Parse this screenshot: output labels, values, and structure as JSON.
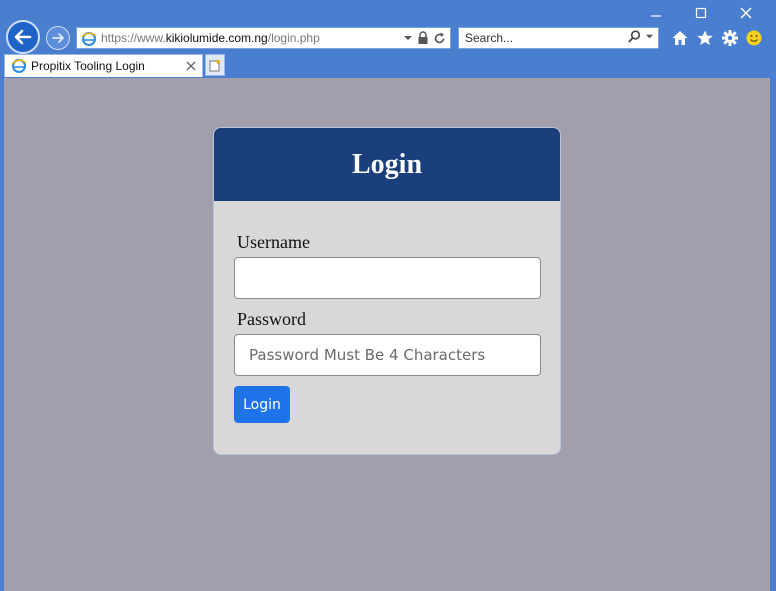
{
  "browser": {
    "address_scheme": "https://www.",
    "address_host": "kikiolumide.com.ng",
    "address_path": "/login.php",
    "search_placeholder": "Search...",
    "tab_title": "Propitix Tooling Login"
  },
  "login": {
    "title": "Login",
    "username_label": "Username",
    "username_value": "",
    "password_label": "Password",
    "password_placeholder": "Password Must Be 4 Characters",
    "submit_label": "Login"
  },
  "colors": {
    "chrome": "#4a7fd0",
    "card_header": "#1a3f7a",
    "button": "#1e73e8",
    "page_bg": "#a19fac"
  }
}
